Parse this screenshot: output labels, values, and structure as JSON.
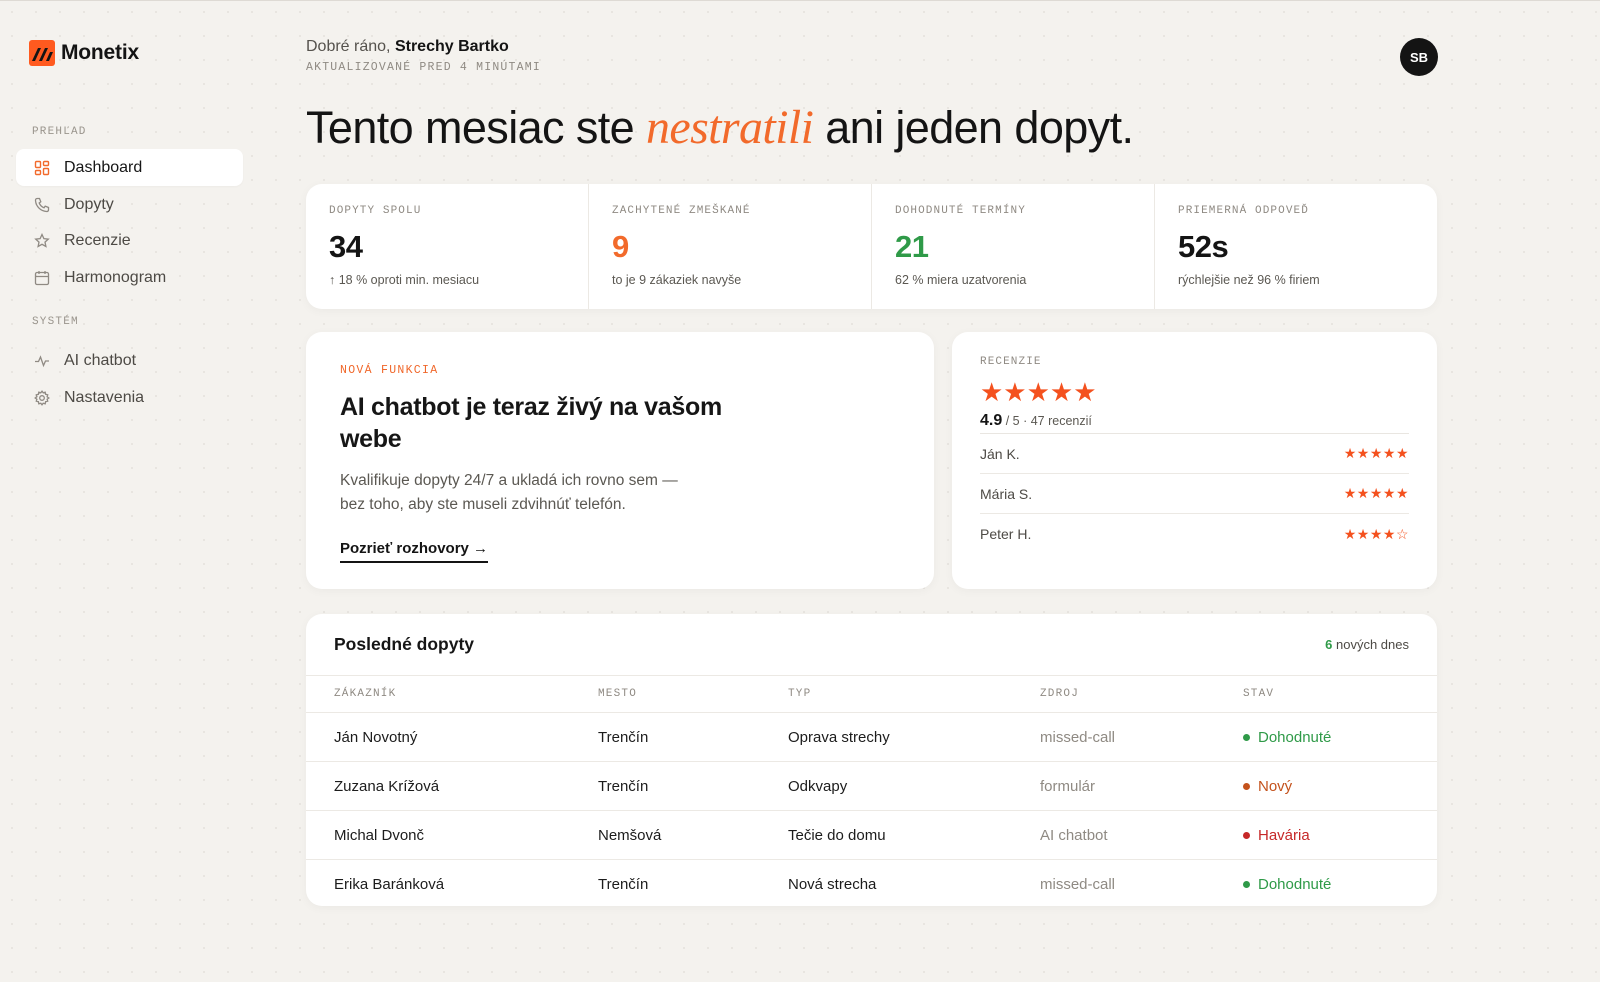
{
  "brand": {
    "name": "Monetix",
    "accent": "#ff5a1f"
  },
  "sidebar": {
    "sections": [
      {
        "title": "PREHĽAD",
        "items": [
          {
            "label": "Dashboard",
            "icon": "grid-icon",
            "active": true
          },
          {
            "label": "Dopyty",
            "icon": "phone-icon"
          },
          {
            "label": "Recenzie",
            "icon": "star-icon"
          },
          {
            "label": "Harmonogram",
            "icon": "calendar-icon"
          }
        ]
      },
      {
        "title": "SYSTÉM",
        "items": [
          {
            "label": "AI chatbot",
            "icon": "activity-icon"
          },
          {
            "label": "Nastavenia",
            "icon": "gear-icon"
          }
        ]
      }
    ]
  },
  "header": {
    "greeting_prefix": "Dobré ráno, ",
    "company": "Strechy Bartko",
    "updated": "AKTUALIZOVANÉ PRED 4 MINÚTAMI",
    "avatar_initials": "SB",
    "headline_before": "Tento mesiac ste ",
    "headline_emphasis": "nestratili",
    "headline_after": " ani jeden dopyt."
  },
  "stats": [
    {
      "label": "DOPYTY SPOLU",
      "value": "34",
      "sub": "↑ 18 % oproti min. mesiacu",
      "color": "#141414"
    },
    {
      "label": "ZACHYTENÉ ZMEŠKANÉ",
      "value": "9",
      "sub": "to je 9 zákaziek navyše",
      "color": "#f26a2b"
    },
    {
      "label": "DOHODNUTÉ TERMÍNY",
      "value": "21",
      "sub": "62 % miera uzatvorenia",
      "color": "#2f9a48"
    },
    {
      "label": "PRIEMERNÁ ODPOVEĎ",
      "value": "52s",
      "sub": "rýchlejšie než 96 % firiem",
      "color": "#141414"
    }
  ],
  "feature": {
    "eyebrow": "NOVÁ FUNKCIA",
    "title": "AI chatbot je teraz živý na vašom webe",
    "description": "Kvalifikuje dopyty 24/7 a ukladá ich rovno sem — bez toho, aby ste museli zdvihnúť telefón.",
    "link": "Pozrieť rozhovory →"
  },
  "reviews": {
    "label": "RECENZIE",
    "stars": "★★★★★",
    "score": "4.9",
    "score_suffix": " / 5 · 47 recenzií",
    "items": [
      {
        "name": "Ján K.",
        "stars": "★★★★★",
        "rating": 5
      },
      {
        "name": "Mária S.",
        "stars": "★★★★★",
        "rating": 5
      },
      {
        "name": "Peter H.",
        "stars": "★★★★☆",
        "rating": 4
      }
    ]
  },
  "table": {
    "title": "Posledné dopyty",
    "new_count": "6",
    "new_label": " nových dnes",
    "columns": [
      "ZÁKAZNÍK",
      "MESTO",
      "TYP",
      "ZDROJ",
      "STAV"
    ],
    "rows": [
      {
        "customer": "Ján Novotný",
        "city": "Trenčín",
        "type": "Oprava strechy",
        "source": "missed-call",
        "status": "Dohodnuté",
        "status_color": "#2f9a48"
      },
      {
        "customer": "Zuzana Krížová",
        "city": "Trenčín",
        "type": "Odkvapy",
        "source": "formulár",
        "status": "Nový",
        "status_color": "#c4521c"
      },
      {
        "customer": "Michal Dvonč",
        "city": "Nemšová",
        "type": "Tečie do domu",
        "source": "AI chatbot",
        "status": "Havária",
        "status_color": "#c62828"
      },
      {
        "customer": "Erika Baránková",
        "city": "Trenčín",
        "type": "Nová strecha",
        "source": "missed-call",
        "status": "Dohodnuté",
        "status_color": "#2f9a48"
      }
    ]
  }
}
